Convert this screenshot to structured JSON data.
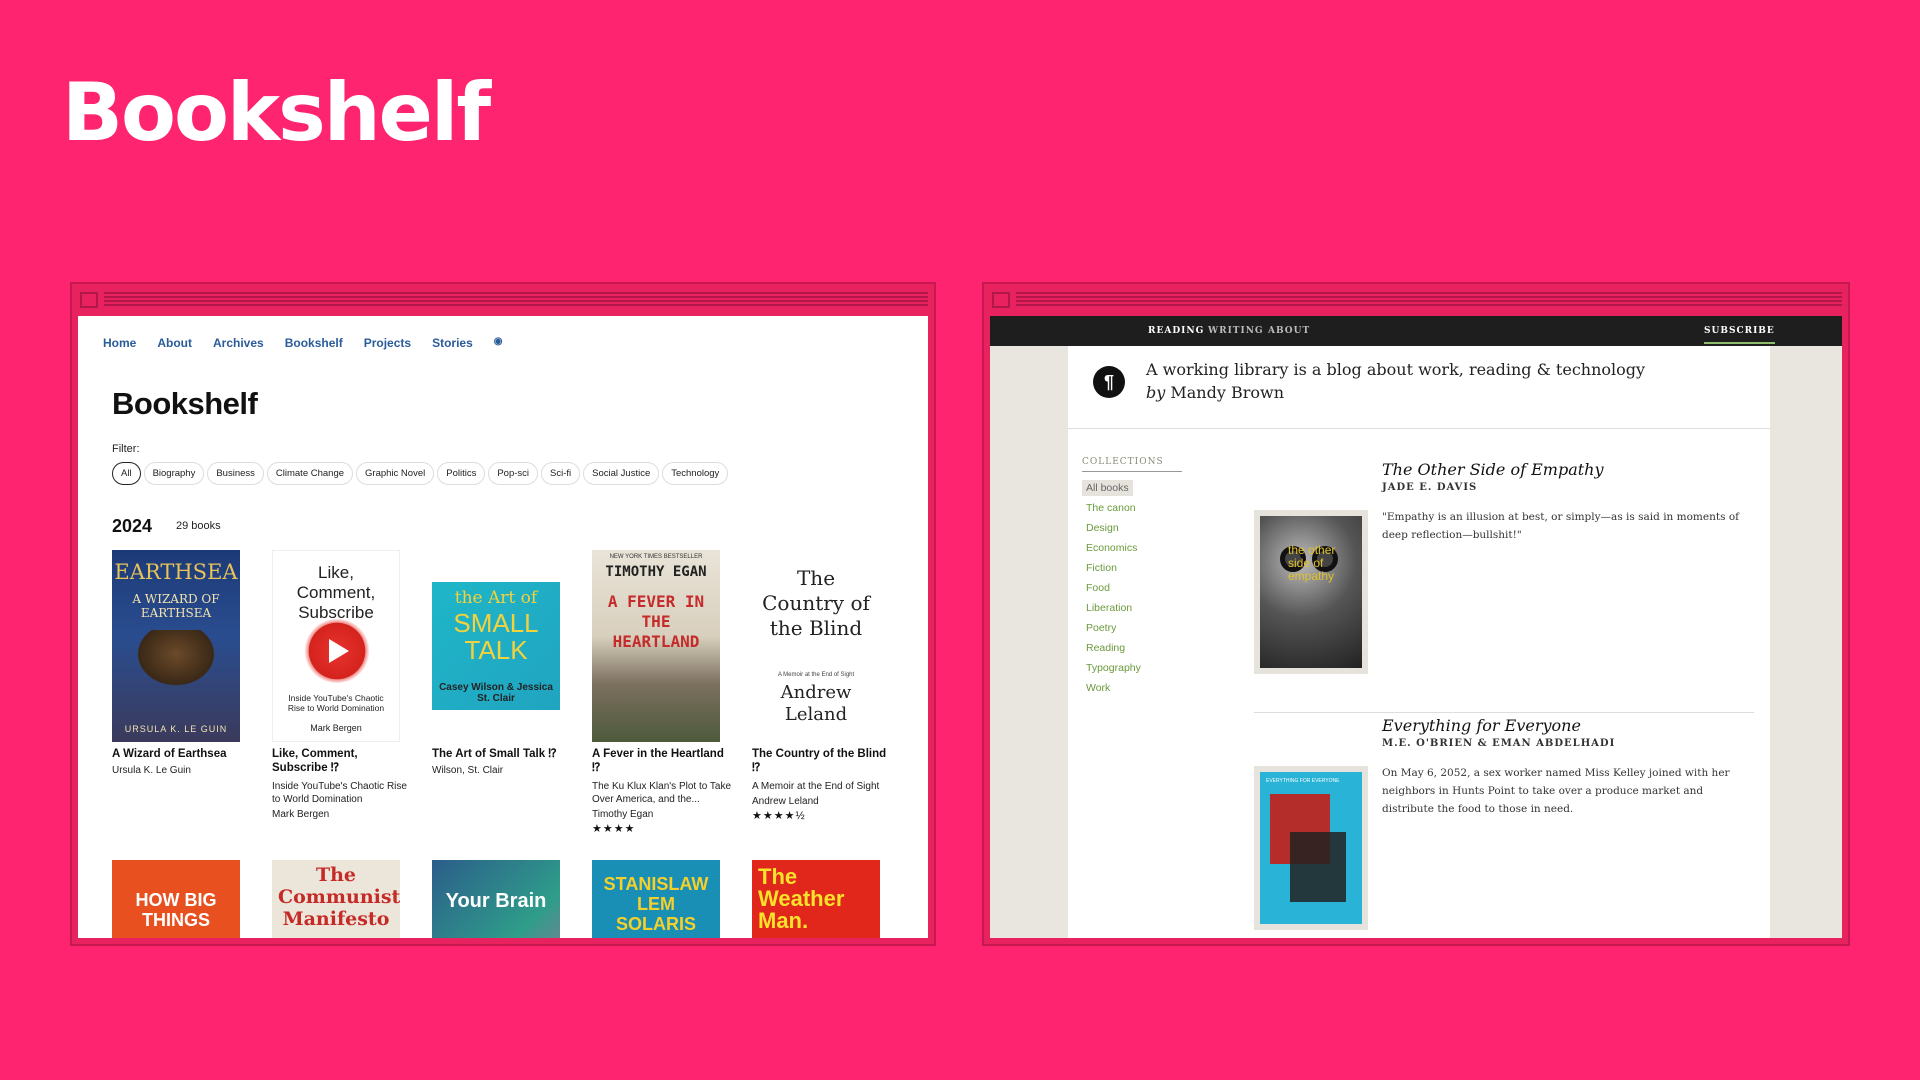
{
  "slide_title": "Bookshelf",
  "left": {
    "nav": [
      "Home",
      "About",
      "Archives",
      "Bookshelf",
      "Projects",
      "Stories"
    ],
    "rss_icon": "rss-icon",
    "heading": "Bookshelf",
    "filter_label": "Filter:",
    "filters": [
      "All",
      "Biography",
      "Business",
      "Climate Change",
      "Graphic Novel",
      "Politics",
      "Pop-sci",
      "Sci-fi",
      "Social Justice",
      "Technology"
    ],
    "active_filter": "All",
    "year": "2024",
    "count": "29 books",
    "books": [
      {
        "title": "A Wizard of Earthsea",
        "subtitle": "",
        "author": "Ursula K. Le Guin",
        "stars": "",
        "cover": {
          "l1": "EARTHSEA",
          "l2": "A WIZARD OF EARTHSEA",
          "l3": "URSULA K. LE GUIN"
        }
      },
      {
        "title": "Like, Comment, Subscribe ⁉",
        "subtitle": "Inside YouTube's Chaotic Rise to World Domination",
        "author": "Mark Bergen",
        "stars": "",
        "cover": {
          "l1": "Like, Comment, Subscribe",
          "l2": "Inside YouTube's Chaotic Rise to World Domination",
          "l3": "Mark Bergen"
        }
      },
      {
        "title": "The Art of Small Talk ⁉",
        "subtitle": "",
        "author": "Wilson, St. Clair",
        "stars": "",
        "cover": {
          "l1": "the Art of",
          "l2": "SMALL TALK",
          "l3": "Casey Wilson & Jessica St. Clair"
        }
      },
      {
        "title": "A Fever in the Heartland ⁉",
        "subtitle": "The Ku Klux Klan's Plot to Take Over America, and the...",
        "author": "Timothy Egan",
        "stars": "★★★★",
        "cover": {
          "l1": "TIMOTHY EGAN",
          "l2": "A FEVER IN THE HEARTLAND",
          "l3": "NEW YORK TIMES BESTSELLER"
        }
      },
      {
        "title": "The Country of the Blind ⁉",
        "subtitle": "A Memoir at the End of Sight",
        "author": "Andrew Leland",
        "stars": "★★★★½",
        "cover": {
          "l1": "The Country of the Blind",
          "l2": "A Memoir at the End of Sight",
          "l3": "Andrew Leland"
        }
      }
    ],
    "row2_covers": [
      {
        "l1": "HOW BIG THINGS"
      },
      {
        "l1": "The Communist Manifesto"
      },
      {
        "l1": "Your Brain"
      },
      {
        "l1": "STANISLAW LEM SOLARIS"
      },
      {
        "l1": "The Weather Man."
      }
    ]
  },
  "right": {
    "nav": [
      "READING",
      "WRITING",
      "ABOUT"
    ],
    "subscribe": "SUBSCRIBE",
    "logo_glyph": "¶",
    "tagline": "A working library is a blog about work, reading & technology",
    "by": "by",
    "author": "Mandy Brown",
    "collections_heading": "COLLECTIONS",
    "collections": [
      "All books",
      "The canon",
      "Design",
      "Economics",
      "Fiction",
      "Food",
      "Liberation",
      "Poetry",
      "Reading",
      "Typography",
      "Work"
    ],
    "entries": [
      {
        "title": "The Other Side of Empathy",
        "author": "JADE E. DAVIS",
        "desc": "\"Empathy is an illusion at best, or simply—as is said in moments of deep reflection—bullshit!\"",
        "cover_text": "the other side of empathy"
      },
      {
        "title": "Everything for Everyone",
        "author": "M.E. O'BRIEN & EMAN ABDELHADI",
        "desc": "On May 6, 2052, a sex worker named Miss Kelley joined with her neighbors in Hunts Point to take over a produce market and distribute the food to those in need.",
        "cover_text": "EVERYTHING FOR EVERYONE"
      }
    ]
  },
  "colors": {
    "background": "#ff2470",
    "link": "#2a5c9a",
    "collection_link": "#6a9a3c"
  }
}
